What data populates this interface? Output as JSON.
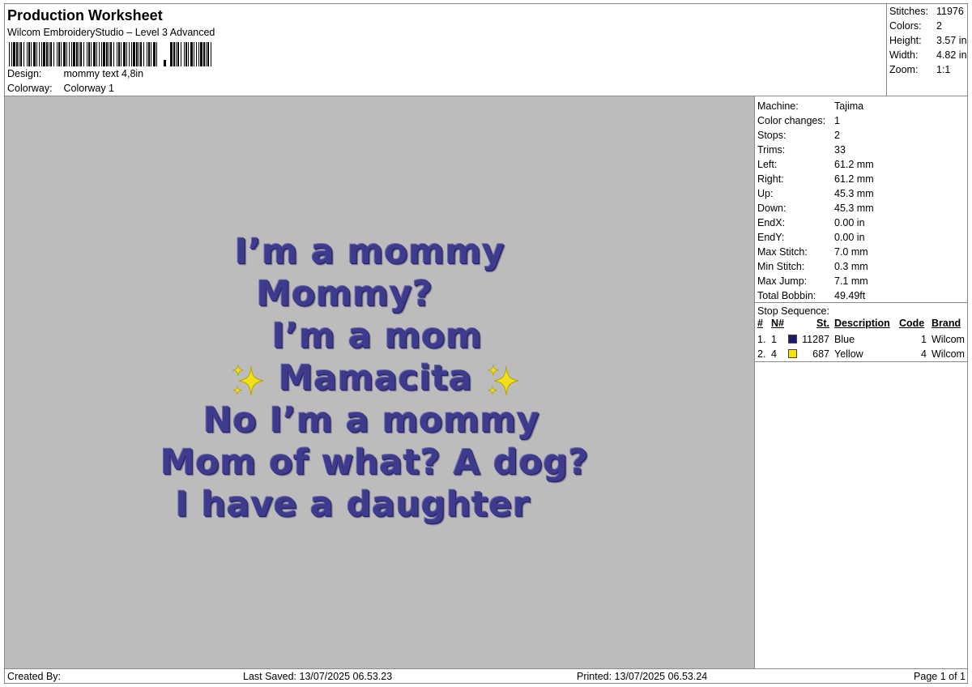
{
  "header": {
    "title": "Production Worksheet",
    "subtitle": "Wilcom EmbroideryStudio – Level 3 Advanced",
    "design_label": "Design:",
    "design_value": "mommy text 4,8in",
    "colorway_label": "Colorway:",
    "colorway_value": "Colorway 1"
  },
  "summary": {
    "stitches_label": "Stitches:",
    "stitches_value": "11976",
    "colors_label": "Colors:",
    "colors_value": "2",
    "height_label": "Height:",
    "height_value": "3.57 in",
    "width_label": "Width:",
    "width_value": "4.82 in",
    "zoom_label": "Zoom:",
    "zoom_value": "1:1"
  },
  "preview": {
    "line1": "I’m a mommy",
    "line2": "Mommy?",
    "line3": "I’m a mom",
    "line4": "Mamacita",
    "line5": "No I’m a mommy",
    "line6": "Mom of what? A dog?",
    "line7": "I  have  a  daughter",
    "thread_color": "#3e3a8c",
    "sparkle_color": "#f2e01a",
    "background": "#bcbcbc"
  },
  "machine": {
    "machine_label": "Machine:",
    "machine_value": "Tajima",
    "color_changes_label": "Color changes:",
    "color_changes_value": "1",
    "stops_label": "Stops:",
    "stops_value": "2",
    "trims_label": "Trims:",
    "trims_value": "33",
    "left_label": "Left:",
    "left_value": "61.2 mm",
    "right_label": "Right:",
    "right_value": "61.2 mm",
    "up_label": "Up:",
    "up_value": "45.3 mm",
    "down_label": "Down:",
    "down_value": "45.3 mm",
    "endx_label": "EndX:",
    "endx_value": "0.00 in",
    "endy_label": "EndY:",
    "endy_value": "0.00 in",
    "max_stitch_label": "Max Stitch:",
    "max_stitch_value": "7.0 mm",
    "min_stitch_label": "Min Stitch:",
    "min_stitch_value": "0.3 mm",
    "max_jump_label": "Max Jump:",
    "max_jump_value": "7.1 mm",
    "total_bobbin_label": "Total Bobbin:",
    "total_bobbin_value": "49.49ft"
  },
  "stop_sequence": {
    "title": "Stop Sequence:",
    "columns": {
      "num": "#",
      "n": "N#",
      "st": "St.",
      "description": "Description",
      "code": "Code",
      "brand": "Brand"
    },
    "rows": [
      {
        "num": "1.",
        "n": "1",
        "color": "#1f1a6e",
        "st": "11287",
        "description": "Blue",
        "code": "1",
        "brand": "Wilcom"
      },
      {
        "num": "2.",
        "n": "4",
        "color": "#f5e400",
        "st": "687",
        "description": "Yellow",
        "code": "4",
        "brand": "Wilcom"
      }
    ]
  },
  "footer": {
    "created_by": "Created By:",
    "last_saved": "Last Saved: 13/07/2025 06.53.23",
    "printed": "Printed: 13/07/2025 06.53.24",
    "page": "Page 1 of 1"
  }
}
